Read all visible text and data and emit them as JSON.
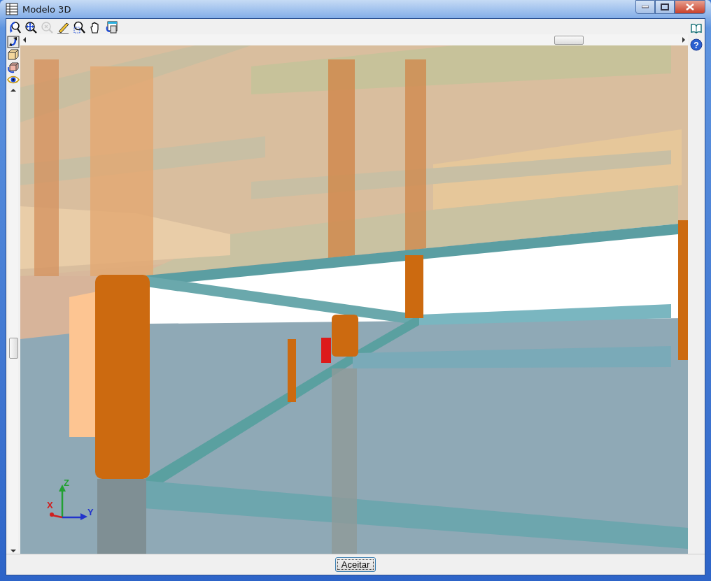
{
  "window": {
    "title": "Modelo 3D"
  },
  "toolbar": [
    {
      "kind": "orbit",
      "disabled": false
    },
    {
      "kind": "zoom-all",
      "disabled": false
    },
    {
      "kind": "zoom-x2",
      "disabled": true
    },
    {
      "kind": "pencil",
      "disabled": false
    },
    {
      "kind": "zoom-window",
      "disabled": false
    },
    {
      "kind": "pan",
      "disabled": false
    },
    {
      "kind": "window",
      "disabled": false
    }
  ],
  "side_toolbar": [
    {
      "kind": "rotate"
    },
    {
      "kind": "solid"
    },
    {
      "kind": "transparent"
    },
    {
      "kind": "eye"
    }
  ],
  "right_toolbar": [
    {
      "kind": "book"
    },
    {
      "kind": "help",
      "glyph": "?"
    }
  ],
  "axes": [
    {
      "label": "Z",
      "color": "#22a033"
    },
    {
      "label": "X",
      "color": "#d02020"
    },
    {
      "label": "Y",
      "color": "#2233cc"
    }
  ],
  "buttons": [
    "Aceitar"
  ]
}
